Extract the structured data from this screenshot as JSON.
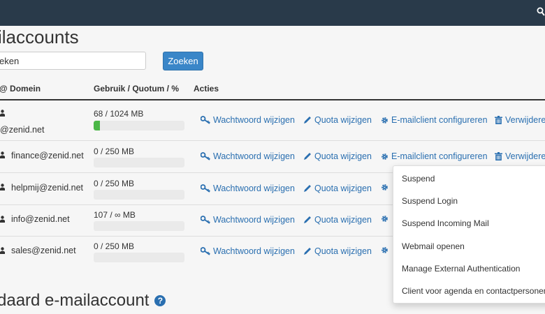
{
  "page": {
    "title": "ilaccounts",
    "search": {
      "value": "eken",
      "button_label": "Zoeken"
    },
    "columns": {
      "account": "@ Domein",
      "usage": "Gebruik / Quotum / %",
      "actions": "Acties"
    },
    "action_labels": {
      "password": "Wachtwoord wijzigen",
      "quota": "Quota wijzigen",
      "configure": "E-mailclient configureren",
      "delete": "Verwijderen"
    },
    "rows": [
      {
        "email": "@zenid.net",
        "usage": "68 / 1024 MB",
        "fill": 0.066
      },
      {
        "email": "finance@zenid.net",
        "usage": "0 / 250 MB",
        "fill": 0
      },
      {
        "email": "helpmij@zenid.net",
        "usage": "0 / 250 MB",
        "fill": 0
      },
      {
        "email": "info@zenid.net",
        "usage": "107 / ∞ MB",
        "fill": 0
      },
      {
        "email": "sales@zenid.net",
        "usage": "0 / 250 MB",
        "fill": 0
      }
    ],
    "default_section_title": "daard e-mailaccount",
    "dropdown_menu": [
      "Suspend",
      "Suspend Login",
      "Suspend Incoming Mail",
      "Webmail openen",
      "Manage External Authentication",
      "Client voor agenda en contactpersonen"
    ],
    "colors": {
      "topbar": "#293a4a",
      "link": "#2a6fb0",
      "primary_button": "#3a86c8",
      "progress": "#4bb747"
    }
  }
}
